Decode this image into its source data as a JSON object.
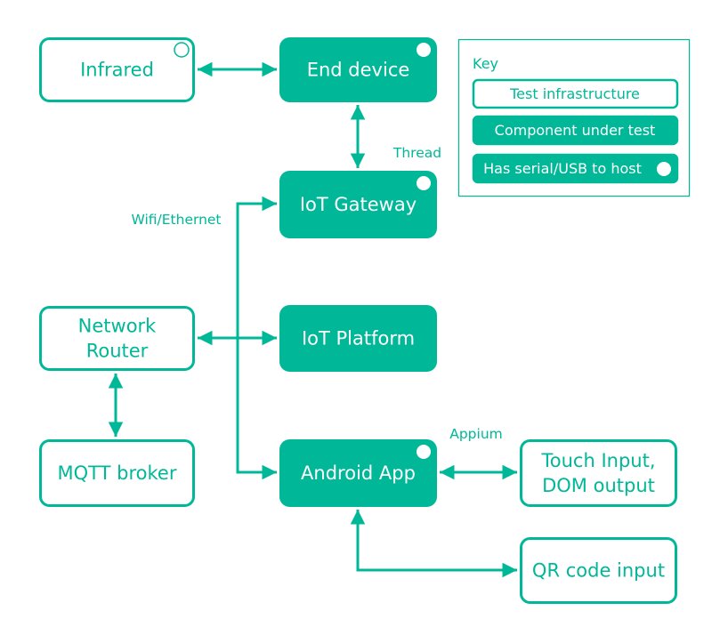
{
  "colors": {
    "accent": "#00b898",
    "background": "#ffffff",
    "filled_text": "#ffffff"
  },
  "nodes": {
    "infrared": {
      "lines": [
        "Infrared"
      ],
      "style": "outline",
      "serial": true
    },
    "end_device": {
      "lines": [
        "End device"
      ],
      "style": "filled",
      "serial": true
    },
    "iot_gateway": {
      "lines": [
        "IoT Gateway"
      ],
      "style": "filled",
      "serial": true
    },
    "iot_platform": {
      "lines": [
        "IoT Platform"
      ],
      "style": "filled",
      "serial": false
    },
    "android_app": {
      "lines": [
        "Android App"
      ],
      "style": "filled",
      "serial": true
    },
    "network_router": {
      "lines": [
        "Network",
        "Router"
      ],
      "style": "outline",
      "serial": false
    },
    "mqtt_broker": {
      "lines": [
        "MQTT broker"
      ],
      "style": "outline",
      "serial": false
    },
    "touch_input": {
      "lines": [
        "Touch Input,",
        "DOM output"
      ],
      "style": "outline",
      "serial": false
    },
    "qr_code_input": {
      "lines": [
        "QR code input"
      ],
      "style": "outline",
      "serial": false
    }
  },
  "edge_labels": {
    "thread": "Thread",
    "wifi": "Wifi/Ethernet",
    "appium": "Appium"
  },
  "key": {
    "title": "Key",
    "items": [
      {
        "label": "Test infrastructure",
        "style": "outline"
      },
      {
        "label": "Component under test",
        "style": "filled"
      },
      {
        "label": "Has serial/USB to host",
        "style": "filled",
        "serial": true
      }
    ]
  }
}
